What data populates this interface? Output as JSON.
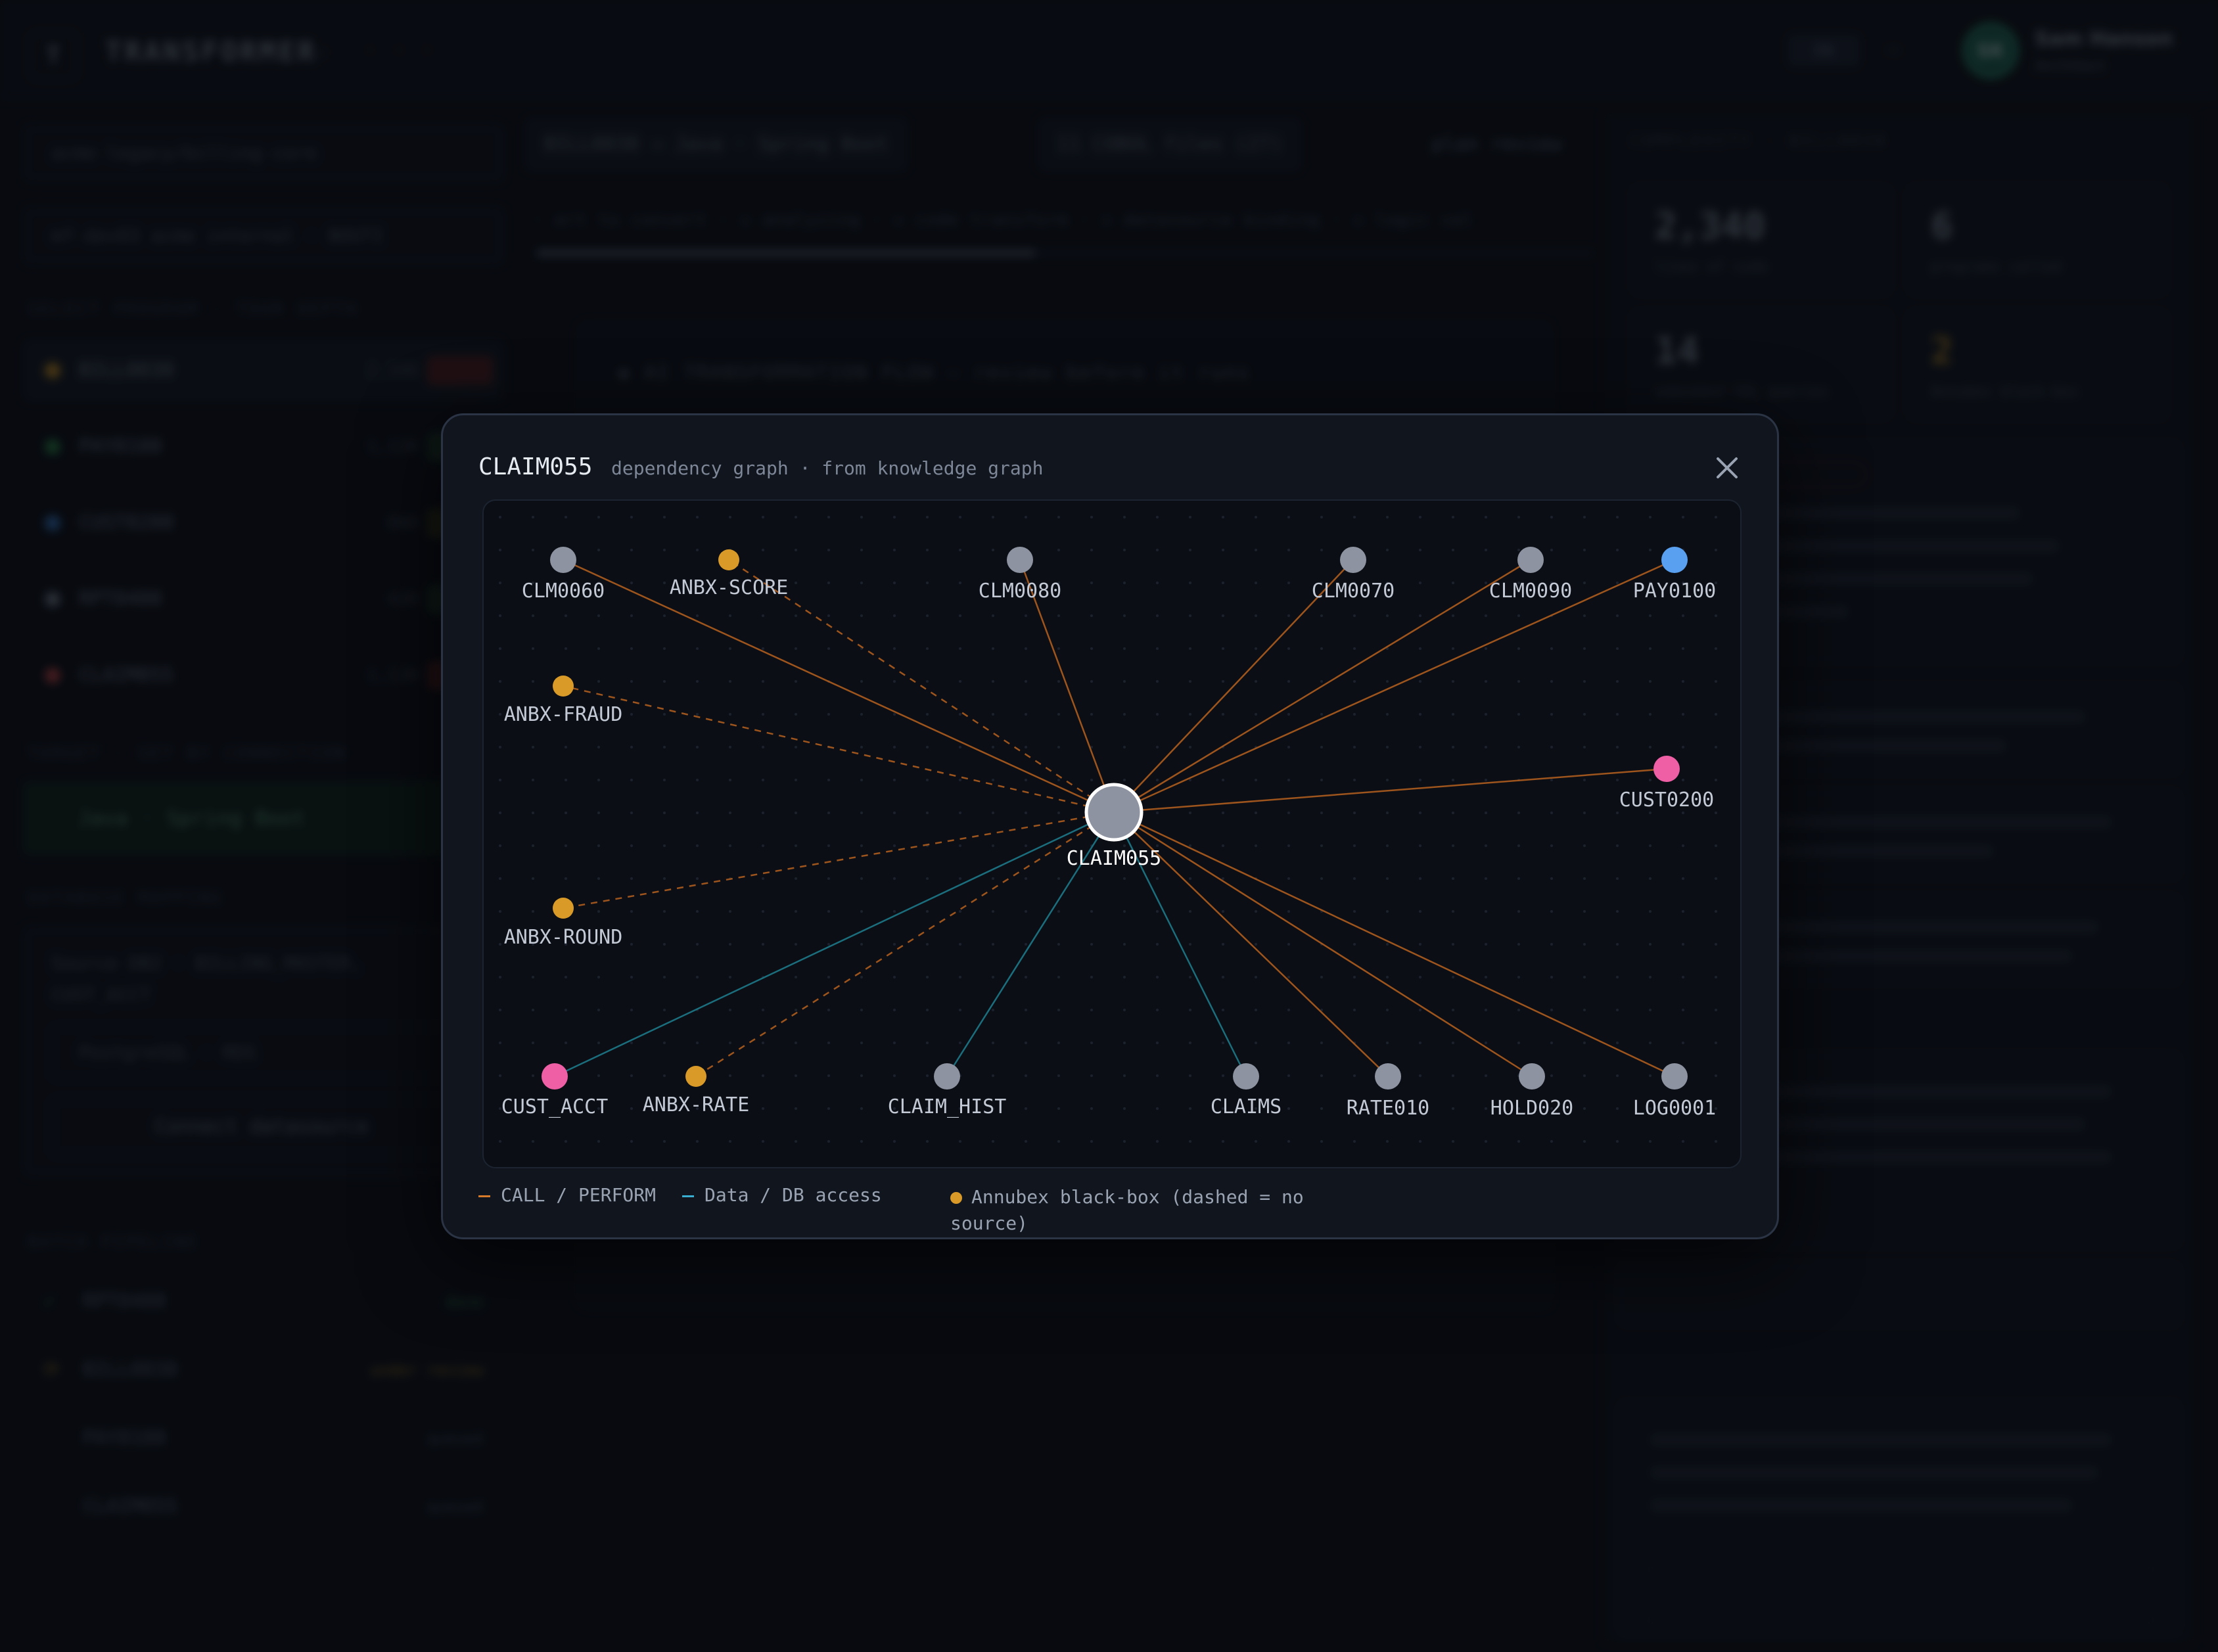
{
  "background": {
    "brand": {
      "logo_letter": "T",
      "name": "TRANSFORMER",
      "caret": "⌄",
      "dots": "· · ·"
    },
    "topbar": {
      "chip": "EN",
      "dash": "—",
      "avatar_initials": "SK",
      "user_name": "Sam Hanson",
      "user_role": "Architect"
    },
    "left": {
      "repo": "acme-legacy/billing-core",
      "branch": "mf-dev03 acme internal · BOUTI",
      "section_programs": "SELECT PROGRAM · TOUR DEPTH",
      "programs": [
        {
          "name": "BILL0030",
          "count": "2,340",
          "dot": "#d99a27",
          "tag": "#5a2020"
        },
        {
          "name": "PAY0100",
          "count": "1,120",
          "dot": "#2e8f4a",
          "tag": "#1e3a25"
        },
        {
          "name": "CUST0200",
          "count": "860",
          "dot": "#3a7fd0",
          "tag": "#3a3a1a"
        },
        {
          "name": "RPT0400",
          "count": "420",
          "dot": "#7b8393",
          "tag": "#1e3a25"
        },
        {
          "name": "CLAIM055",
          "count": "1,120",
          "dot": "#d04a4a",
          "tag": "#5a2020"
        }
      ],
      "section_target": "TARGET · SET BY CONNECTION",
      "target": "Java · Spring Boot",
      "section_db": "DATABASE MAPPING",
      "db_source": "Source DB2 · BILLING_MASTER, CUST_ACCT",
      "db_target": "PostgreSQL · RDS",
      "db_button": "Connect datasource",
      "section_batch": "BATCH PIPELINE",
      "batch": [
        {
          "mark": "✓",
          "name": "RPT0400",
          "status": "done"
        },
        {
          "mark": "⟳",
          "name": "BILL0030",
          "status": "under review"
        },
        {
          "mark": "",
          "name": "PAY0100",
          "status": "queued"
        },
        {
          "mark": "",
          "name": "CLAIM055",
          "status": "queued"
        }
      ]
    },
    "center": {
      "tabs": [
        "BILL0030  →  Java · Spring Boot",
        "11 COBOL files (27)",
        "plan review"
      ],
      "steps": "· art to convert  · ◇ analyzing  · ◇ code transform  · ◇ datasource binding  · ◇ logic val",
      "flow_title": "◆ AI TRANSFORMATION FLOW — review before it runs"
    },
    "right": {
      "heading": "COMPLEXITY · BILL0030",
      "stats": [
        {
          "value": "2,340",
          "label": "lines of code"
        },
        {
          "value": "6",
          "label": "programs called"
        },
        {
          "value": "14",
          "label": "embedded SQL queries"
        },
        {
          "value": "2",
          "label": "Annubex black-box"
        }
      ]
    }
  },
  "modal": {
    "title": "CLAIM055",
    "subtitle": "dependency graph · from knowledge graph",
    "center_node": "CLAIM055",
    "nodes": [
      {
        "id": "CLM0060",
        "kind": "program",
        "edge": "call"
      },
      {
        "id": "ANBX-SCORE",
        "kind": "annubex",
        "edge": "annubex"
      },
      {
        "id": "CLM0080",
        "kind": "program",
        "edge": "call"
      },
      {
        "id": "CLM0070",
        "kind": "program",
        "edge": "call"
      },
      {
        "id": "CLM0090",
        "kind": "program",
        "edge": "call"
      },
      {
        "id": "PAY0100",
        "kind": "program-blue",
        "edge": "call"
      },
      {
        "id": "ANBX-FRAUD",
        "kind": "annubex",
        "edge": "annubex"
      },
      {
        "id": "CUST0200",
        "kind": "program-pink",
        "edge": "call"
      },
      {
        "id": "ANBX-ROUND",
        "kind": "annubex",
        "edge": "annubex"
      },
      {
        "id": "CUST_ACCT",
        "kind": "data-pink",
        "edge": "data"
      },
      {
        "id": "ANBX-RATE",
        "kind": "annubex",
        "edge": "annubex"
      },
      {
        "id": "CLAIM_HIST",
        "kind": "data",
        "edge": "data"
      },
      {
        "id": "CLAIMS",
        "kind": "data",
        "edge": "data"
      },
      {
        "id": "RATE010",
        "kind": "program",
        "edge": "call"
      },
      {
        "id": "HOLD020",
        "kind": "program",
        "edge": "call"
      },
      {
        "id": "LOG0001",
        "kind": "program",
        "edge": "call"
      }
    ],
    "colors": {
      "call_edge": "#b8621f",
      "data_edge": "#1f7f8f",
      "annubex_node": "#d99a27",
      "program_node": "#8d93a0",
      "blue_node": "#5aa0f0",
      "pink_node": "#ee5fa6",
      "center_node": "#8d93a0"
    },
    "legend": {
      "call": "CALL / PERFORM",
      "data": "Data / DB access",
      "annubex": "Annubex black-box (dashed = no source)"
    }
  }
}
